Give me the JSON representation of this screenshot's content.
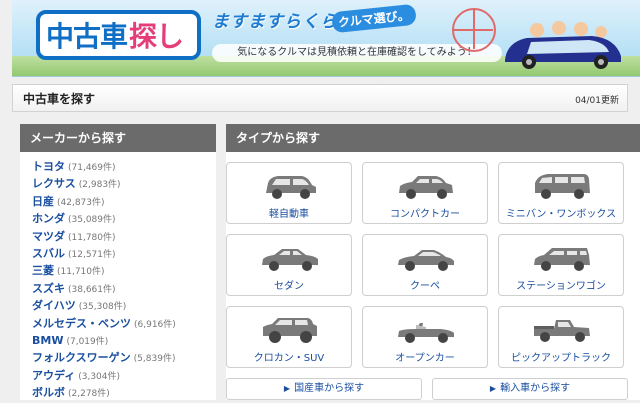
{
  "banner": {
    "logo_part1": "中古車",
    "logo_part2": "探し",
    "tagline": "ますますらくらく",
    "tagline_badge": "クルマ選び。",
    "subcopy": "気になるクルマは見積依頼と在庫確認をしてみよう！"
  },
  "header": {
    "title": "中古車を探す",
    "updated": "04/01更新"
  },
  "maker_panel": {
    "heading": "メーカーから探す",
    "items": [
      {
        "name": "トヨタ",
        "count": "(71,469件)"
      },
      {
        "name": "レクサス",
        "count": "(2,983件)"
      },
      {
        "name": "日産",
        "count": "(42,873件)"
      },
      {
        "name": "ホンダ",
        "count": "(35,089件)"
      },
      {
        "name": "マツダ",
        "count": "(11,780件)"
      },
      {
        "name": "スバル",
        "count": "(12,571件)"
      },
      {
        "name": "三菱",
        "count": "(11,710件)"
      },
      {
        "name": "スズキ",
        "count": "(38,661件)"
      },
      {
        "name": "ダイハツ",
        "count": "(35,308件)"
      },
      {
        "name": "メルセデス・ベンツ",
        "count": "(6,916件)"
      },
      {
        "name": "BMW",
        "count": "(7,019件)"
      },
      {
        "name": "フォルクスワーゲン",
        "count": "(5,839件)"
      },
      {
        "name": "アウディ",
        "count": "(3,304件)"
      },
      {
        "name": "ボルボ",
        "count": "(2,278件)"
      }
    ]
  },
  "type_panel": {
    "heading": "タイプから探す",
    "types": [
      {
        "label": "軽自動車",
        "icon": "kei-car-icon"
      },
      {
        "label": "コンパクトカー",
        "icon": "compact-car-icon"
      },
      {
        "label": "ミニバン・ワンボックス",
        "icon": "minivan-icon"
      },
      {
        "label": "セダン",
        "icon": "sedan-icon"
      },
      {
        "label": "クーペ",
        "icon": "coupe-icon"
      },
      {
        "label": "ステーションワゴン",
        "icon": "station-wagon-icon"
      },
      {
        "label": "クロカン・SUV",
        "icon": "suv-icon"
      },
      {
        "label": "オープンカー",
        "icon": "open-car-icon"
      },
      {
        "label": "ピックアップトラック",
        "icon": "pickup-truck-icon"
      }
    ],
    "domestic_button": "国産車から探す",
    "import_button": "輸入車から探す"
  },
  "colors": {
    "link": "#1a4fa0",
    "panel_head": "#6b6b6b",
    "logo_blue": "#0f6fc4",
    "logo_pink": "#e53c7a"
  }
}
